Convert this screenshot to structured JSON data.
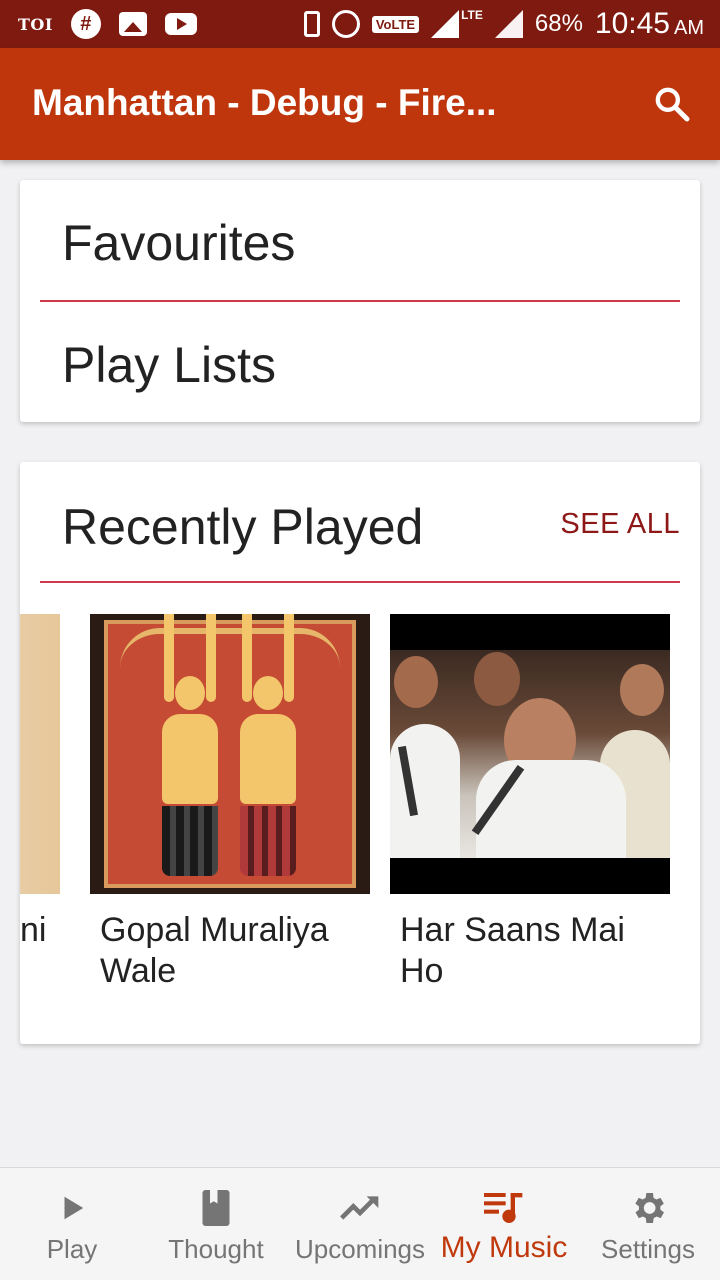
{
  "status_bar": {
    "toi": "TOI",
    "hash": "#",
    "volte": "VoLTE",
    "lte": "LTE",
    "battery": "68%",
    "time": "10:45",
    "ampm": "AM"
  },
  "app_bar": {
    "title": "Manhattan - Debug - Fire..."
  },
  "library": {
    "favourites": "Favourites",
    "playlists": "Play Lists"
  },
  "recently_played": {
    "title": "Recently Played",
    "see_all": "SEE ALL",
    "tracks": [
      {
        "title": "ni"
      },
      {
        "title": "Gopal Muraliya Wale"
      },
      {
        "title": "Har Saans Mai Ho"
      }
    ]
  },
  "bottom_nav": {
    "items": [
      {
        "label": "Play",
        "icon": "play-icon"
      },
      {
        "label": "Thought",
        "icon": "book-icon"
      },
      {
        "label": "Upcomings",
        "icon": "trending-up-icon"
      },
      {
        "label": "My Music",
        "icon": "queue-music-icon",
        "active": true
      },
      {
        "label": "Settings",
        "icon": "gear-icon"
      }
    ]
  },
  "colors": {
    "status_bar": "#7f1a10",
    "app_bar": "#bf360c",
    "accent": "#c0390d",
    "divider": "#d0394d",
    "see_all": "#8e1717"
  }
}
